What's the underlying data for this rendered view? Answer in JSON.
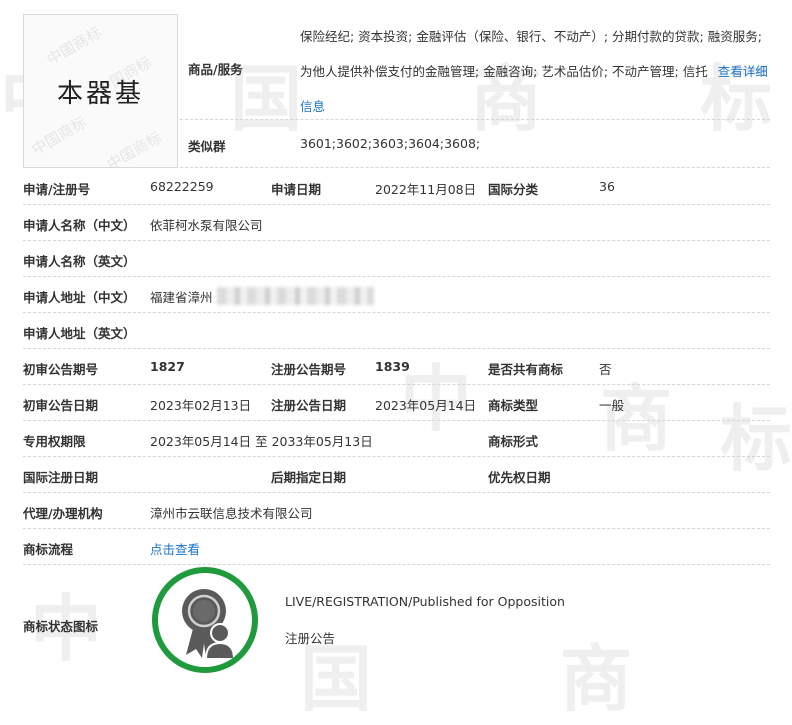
{
  "watermark_chars": [
    "中",
    "国",
    "商",
    "标"
  ],
  "trademark": {
    "mark_text": "本器基",
    "bg_watermark": "中国商标"
  },
  "goods_services": {
    "label": "商品/服务",
    "text": "保险经纪; 资本投资; 金融评估（保险、银行、不动产）; 分期付款的贷款; 融资服务; 为他人提供补偿支付的金融管理; 金融咨询; 艺术品估价; 不动产管理; 信托",
    "link_label": "查看详细信息"
  },
  "similar_group": {
    "label": "类似群",
    "value": "3601;3602;3603;3604;3608;"
  },
  "rows": {
    "app_no_label": "申请/注册号",
    "app_no": "68222259",
    "app_date_label": "申请日期",
    "app_date": "2022年11月08日",
    "intl_class_label": "国际分类",
    "intl_class": "36",
    "applicant_cn_label": "申请人名称（中文）",
    "applicant_cn": "依菲柯水泵有限公司",
    "applicant_en_label": "申请人名称（英文）",
    "address_cn_label": "申请人地址（中文）",
    "address_cn": "福建省漳州",
    "address_en_label": "申请人地址（英文）",
    "prelim_no_label": "初审公告期号",
    "prelim_no": "1827",
    "reg_no_label": "注册公告期号",
    "reg_no": "1839",
    "shared_label": "是否共有商标",
    "shared": "否",
    "prelim_date_label": "初审公告日期",
    "prelim_date": "2023年02月13日",
    "reg_date_label": "注册公告日期",
    "reg_date": "2023年05月14日",
    "type_label": "商标类型",
    "type": "一般",
    "exclusive_label": "专用权期限",
    "exclusive": "2023年05月14日 至 2033年05月13日",
    "form_label": "商标形式",
    "intl_reg_label": "国际注册日期",
    "later_label": "后期指定日期",
    "priority_label": "优先权日期",
    "agent_label": "代理/办理机构",
    "agent": "漳州市云联信息技术有限公司",
    "flow_label": "商标流程",
    "flow_link": "点击查看",
    "status_label": "商标状态图标"
  },
  "status": {
    "line1": "LIVE/REGISTRATION/Published for Opposition",
    "line2": "注册公告"
  },
  "colors": {
    "link": "#1a73c8",
    "status_ring": "#1f9a3c",
    "icon_fill": "#595959"
  },
  "icons": {
    "status": "award-person-icon"
  }
}
